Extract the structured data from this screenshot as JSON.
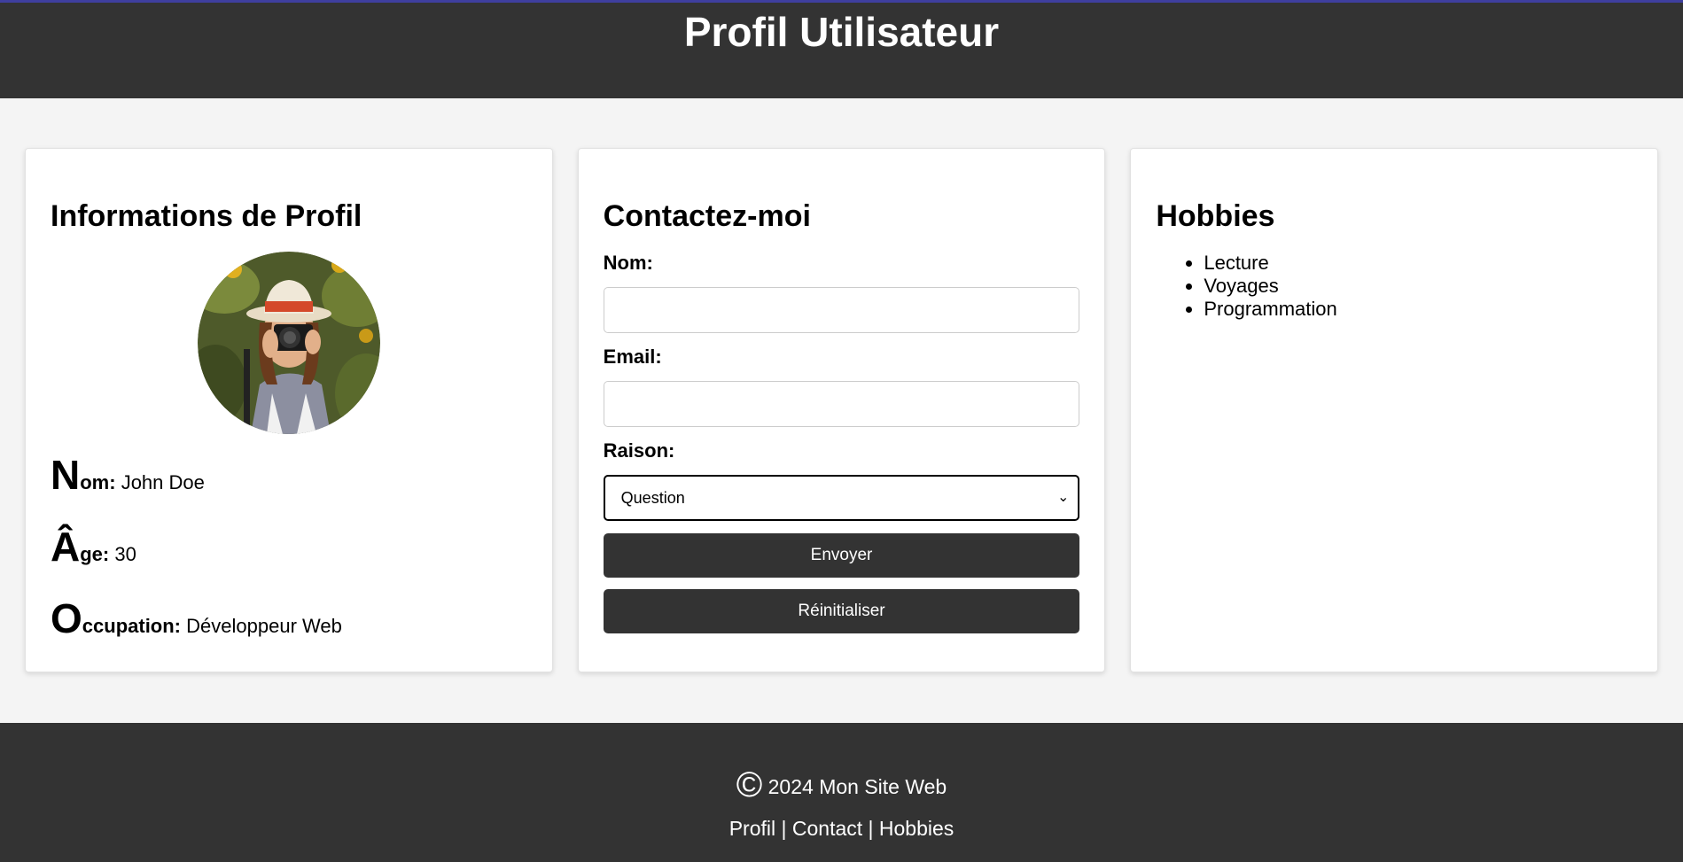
{
  "header": {
    "title": "Profil Utilisateur"
  },
  "profile": {
    "heading": "Informations de Profil",
    "avatar_alt": "photo-icon",
    "fields": [
      {
        "cap": "N",
        "rest": "om:",
        "value": "John Doe"
      },
      {
        "cap": "Â",
        "rest": "ge:",
        "value": "30"
      },
      {
        "cap": "O",
        "rest": "ccupation:",
        "value": "Développeur Web"
      }
    ]
  },
  "contact": {
    "heading": "Contactez-moi",
    "name_label": "Nom:",
    "name_value": "",
    "email_label": "Email:",
    "email_value": "",
    "reason_label": "Raison:",
    "reason_selected": "Question",
    "submit_label": "Envoyer",
    "reset_label": "Réinitialiser"
  },
  "hobbies": {
    "heading": "Hobbies",
    "items": [
      "Lecture",
      "Voyages",
      "Programmation"
    ]
  },
  "footer": {
    "copyright_symbol": "©",
    "copyright_text": "2024 Mon Site Web",
    "links": [
      "Profil",
      "Contact",
      "Hobbies"
    ],
    "separator": "|"
  },
  "colors": {
    "header_bg": "#333333",
    "page_bg": "#f4f4f4",
    "button_bg": "#333333",
    "top_border": "#3f3f9f"
  }
}
